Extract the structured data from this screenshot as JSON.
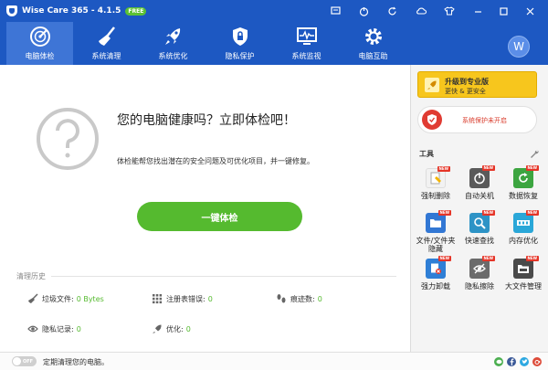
{
  "app": {
    "title": "Wise Care 365 - 4.1.5",
    "badge": "FREE"
  },
  "colors": {
    "brand_blue": "#1d58c2",
    "active_tab": "#3e75d6",
    "accent_green": "#55ba2f",
    "upgrade_yellow": "#f7c61d",
    "warning_red": "#d93b2b"
  },
  "titlebar_icons": [
    "message-icon",
    "power-icon",
    "refresh-icon",
    "cloud-icon",
    "shirt-icon"
  ],
  "nav": {
    "tabs": [
      {
        "label": "电脑体检",
        "icon": "radar-icon"
      },
      {
        "label": "系统清理",
        "icon": "broom-icon"
      },
      {
        "label": "系统优化",
        "icon": "rocket-icon"
      },
      {
        "label": "隐私保护",
        "icon": "shield-lock-icon"
      },
      {
        "label": "系统监视",
        "icon": "monitor-icon"
      },
      {
        "label": "电脑互助",
        "icon": "gear-tools-icon"
      }
    ],
    "avatar_letter": "W"
  },
  "main": {
    "headline": "您的电脑健康吗？立即体检吧！",
    "subtext": "体检能帮您找出潜在的安全问题及可优化项目，并一键修复。",
    "scan_button": "一键体检",
    "history_title": "清理历史"
  },
  "history": {
    "junk_label": "垃圾文件:",
    "junk_value": "0 Bytes",
    "registry_label": "注册表错误:",
    "registry_value": "0",
    "traces_label": "痕迹数:",
    "traces_value": "0",
    "privacy_label": "隐私记录:",
    "privacy_value": "0",
    "optimize_label": "优化:",
    "optimize_value": "0"
  },
  "sidebar": {
    "upgrade_title": "升级到专业版",
    "upgrade_sub": "更快 & 更安全",
    "protect_label": "系统保护未开启",
    "tools_title": "工具",
    "tools": [
      {
        "label": "强制删除",
        "icon": "force-delete-icon",
        "color": "#f2f2f2",
        "new": true
      },
      {
        "label": "自动关机",
        "icon": "auto-shutdown-icon",
        "color": "#5a5a5a",
        "new": true
      },
      {
        "label": "数据恢复",
        "icon": "data-recovery-icon",
        "color": "#3ca540",
        "new": true
      },
      {
        "label": "文件/文件夹隐藏",
        "icon": "folder-hide-icon",
        "color": "#3277d4",
        "new": true
      },
      {
        "label": "快速查找",
        "icon": "quick-search-icon",
        "color": "#2d93c6",
        "new": true
      },
      {
        "label": "内存优化",
        "icon": "memory-optimize-icon",
        "color": "#2aa7d8",
        "new": true
      },
      {
        "label": "强力卸载",
        "icon": "force-uninstall-icon",
        "color": "#2f7fd6",
        "new": true
      },
      {
        "label": "隐私擦除",
        "icon": "privacy-eraser-icon",
        "color": "#6b6b6b",
        "new": true
      },
      {
        "label": "大文件管理",
        "icon": "large-file-icon",
        "color": "#4a4a4a",
        "new": true
      }
    ],
    "new_badge": "NEW"
  },
  "statusbar": {
    "toggle_state": "OFF",
    "schedule_text": "定期清理您的电脑。"
  }
}
